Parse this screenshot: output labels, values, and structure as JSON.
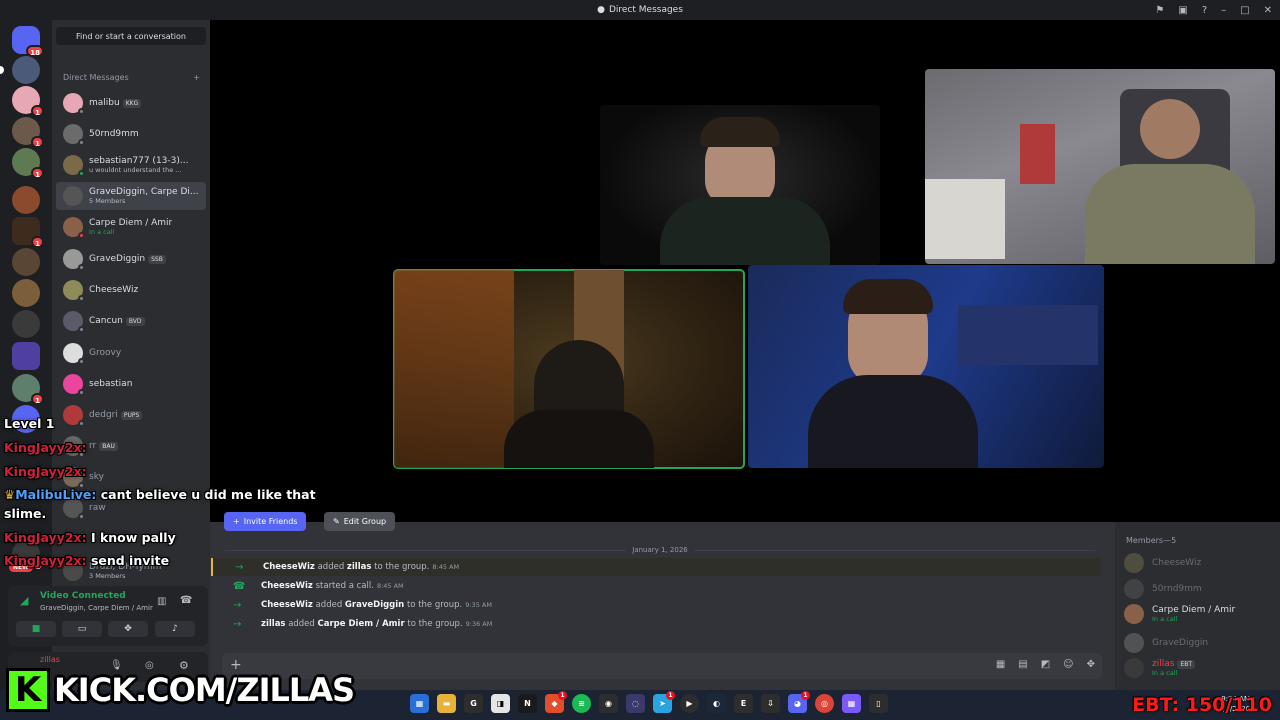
{
  "window": {
    "title": "Direct Messages"
  },
  "rail": {
    "home_badge": "18",
    "server_badges": [
      "1",
      "1",
      "1",
      "1",
      "1",
      "1"
    ],
    "new_badge": "NEW"
  },
  "dm_panel": {
    "search_placeholder": "Find or start a conversation",
    "header": "Direct Messages",
    "add_symbol": "+",
    "items": [
      {
        "name": "malibu",
        "tag": "KKG",
        "sub": ""
      },
      {
        "name": "50rnd9mm",
        "tag": "",
        "sub": ""
      },
      {
        "name": "sebastian777 (13-3)...",
        "tag": "",
        "sub": "u wouldnt understand the ..."
      },
      {
        "name": "GraveDiggin, Carpe Di...",
        "tag": "",
        "sub": "5 Members"
      },
      {
        "name": "Carpe Diem / Amir",
        "tag": "",
        "sub": "In a call"
      },
      {
        "name": "GraveDiggin",
        "tag": "SSB",
        "sub": ""
      },
      {
        "name": "CheeseWiz",
        "tag": "",
        "sub": ""
      },
      {
        "name": "Cancun",
        "tag": "BVD",
        "sub": ""
      },
      {
        "name": "Groovy",
        "tag": "",
        "sub": ""
      },
      {
        "name": "sebastian",
        "tag": "",
        "sub": ""
      },
      {
        "name": "dedgri",
        "tag": "PUPS",
        "sub": ""
      },
      {
        "name": "rr",
        "tag": "BAU",
        "sub": ""
      },
      {
        "name": "sky",
        "tag": "",
        "sub": ""
      },
      {
        "name": "raw",
        "tag": "",
        "sub": ""
      },
      {
        "name": "Druzi, DH-Tymm",
        "tag": "",
        "sub": "3 Members"
      }
    ]
  },
  "voice": {
    "status": "Video Connected",
    "channel": "GraveDiggin, Carpe Diem / Amir"
  },
  "group": {
    "invite_label": "Invite Friends",
    "edit_label": "Edit Group"
  },
  "chat": {
    "date": "January 1, 2026",
    "messages": [
      {
        "actor": "CheeseWiz",
        "verb": "added",
        "target": "zillas",
        "rest": "to the group.",
        "time": "8:45 AM"
      },
      {
        "actor": "CheeseWiz",
        "verb": "started a call.",
        "target": "",
        "rest": "",
        "time": "8:45 AM"
      },
      {
        "actor": "CheeseWiz",
        "verb": "added",
        "target": "GraveDiggin",
        "rest": "to the group.",
        "time": "9:35 AM"
      },
      {
        "actor": "zillas",
        "verb": "added",
        "target": "Carpe Diem / Amir",
        "rest": "to the group.",
        "time": "9:36 AM"
      }
    ]
  },
  "members": {
    "header": "Members—5",
    "list": [
      {
        "name": "CheeseWiz",
        "sub": ""
      },
      {
        "name": "50rnd9mm",
        "sub": ""
      },
      {
        "name": "Carpe Diem / Amir",
        "sub": "In a call"
      },
      {
        "name": "GraveDiggin",
        "sub": ""
      },
      {
        "name": "zillas",
        "tag": "EBT",
        "sub": "In a call"
      }
    ]
  },
  "user": {
    "name": "zillas"
  },
  "overlay": {
    "level": "Level 1",
    "chat": [
      {
        "user": "KingJayy2x:",
        "text": ""
      },
      {
        "user": "KingJayy2x:",
        "text": ""
      },
      {
        "user": "MalibuLive:",
        "text": "cant believe u did me like that"
      },
      {
        "user": "",
        "text": "slime."
      },
      {
        "user": "KingJayy2x:",
        "text": "I know pally"
      },
      {
        "user": "KingJayy2x:",
        "text": "send invite"
      }
    ],
    "kick_url": "KICK.COM/ZILLAS",
    "ebt": "EBT: 150/110"
  },
  "taskbar": {
    "time": "9:54 AM",
    "date": "1/1/2026"
  }
}
